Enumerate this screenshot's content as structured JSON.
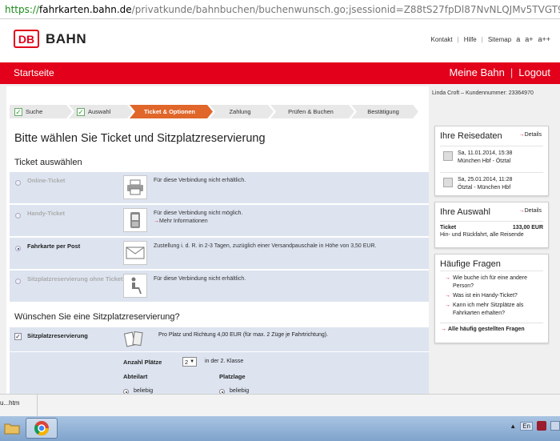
{
  "browser": {
    "url_scheme": "https://",
    "url_host": "fahrkarten.bahn.de",
    "url_path": "/privatkunde/bahnbuchen/buchenwunsch.go;jsessionid=Z88tS27fpDl87NvNLQJMv5TVGT9WYRyrH2NtqCBykpN"
  },
  "header": {
    "logo": "DB",
    "brand": "BAHN",
    "links": [
      "Kontakt",
      "Hilfe",
      "Sitemap"
    ],
    "font_sizes": [
      "a",
      "a+",
      "a++"
    ]
  },
  "nav": {
    "home": "Startseite",
    "meine_bahn": "Meine Bahn",
    "logout": "Logout"
  },
  "user_line": "Linda Croft – Kundennummer: 23364970",
  "steps": [
    {
      "label": "Suche",
      "state": "done"
    },
    {
      "label": "Auswahl",
      "state": "done"
    },
    {
      "label": "Ticket & Optionen",
      "state": "active"
    },
    {
      "label": "Zahlung",
      "state": "todo"
    },
    {
      "label": "Prüfen & Buchen",
      "state": "todo"
    },
    {
      "label": "Bestätigung",
      "state": "todo"
    }
  ],
  "main": {
    "title": "Bitte wählen Sie Ticket und Sitzplatzreservierung",
    "ticket_heading": "Ticket auswählen",
    "options": [
      {
        "label": "Online-Ticket",
        "desc": "Für diese Verbindung nicht erhältlich.",
        "more": "",
        "icon": "printer-icon",
        "enabled": false,
        "selected": false
      },
      {
        "label": "Handy-Ticket",
        "desc": "Für diese Verbindung nicht möglich.",
        "more": "Mehr Informationen",
        "icon": "mobile-phone-icon",
        "enabled": false,
        "selected": false
      },
      {
        "label": "Fahrkarte per Post",
        "desc": "Zustellung i. d. R. in 2-3 Tagen, zuzüglich einer Versandpauschale in Höhe von 3,50 EUR.",
        "more": "",
        "icon": "envelope-icon",
        "enabled": true,
        "selected": true
      },
      {
        "label": "Sitzplatzreservierung ohne Ticket",
        "desc": "Für diese Verbindung nicht erhältlich.",
        "more": "",
        "icon": "seat-icon",
        "enabled": false,
        "selected": false
      }
    ],
    "reservation_heading": "Wünschen Sie eine Sitzplatzreservierung?",
    "reservation": {
      "label": "Sitzplatzreservierung",
      "checked": true,
      "desc": "Pro Platz und Richtung 4,00 EUR (für max. 2 Züge je Fahrtrichtung).",
      "count_label": "Anzahl Plätze",
      "count_value": "2",
      "class_text": "in der 2. Klasse",
      "abteilart_label": "Abteilart",
      "abteilart_value": "beliebig",
      "platzlage_label": "Platzlage",
      "platzlage_value": "beliebig"
    }
  },
  "sidebar": {
    "reisedaten": {
      "title": "Ihre Reisedaten",
      "details": "Details",
      "trips": [
        {
          "date": "Sa, 11.01.2014, 15:38",
          "route": "München Hbf - Ötztal"
        },
        {
          "date": "Sa, 25.01.2014, 11:28",
          "route": "Ötztal - München Hbf"
        }
      ]
    },
    "auswahl": {
      "title": "Ihre Auswahl",
      "details": "Details",
      "item_label": "Ticket",
      "item_price": "133,00 EUR",
      "item_sub": "Hin- und Rückfahrt, alle Reisende"
    },
    "faq": {
      "title": "Häufige Fragen",
      "items": [
        "Wie buche ich für eine andere Person?",
        "Was ist ein Handy-Ticket?",
        "Kann ich mehr Sitzplätze als Fahrkarten erhalten?"
      ],
      "all": "Alle häufig gestellten Fragen"
    }
  },
  "downloads": {
    "item": "u...htm"
  },
  "taskbar": {
    "lang": "En"
  },
  "colors": {
    "db_red": "#e2001a",
    "step_active": "#e0662a",
    "row_bg": "#dde4f0"
  }
}
